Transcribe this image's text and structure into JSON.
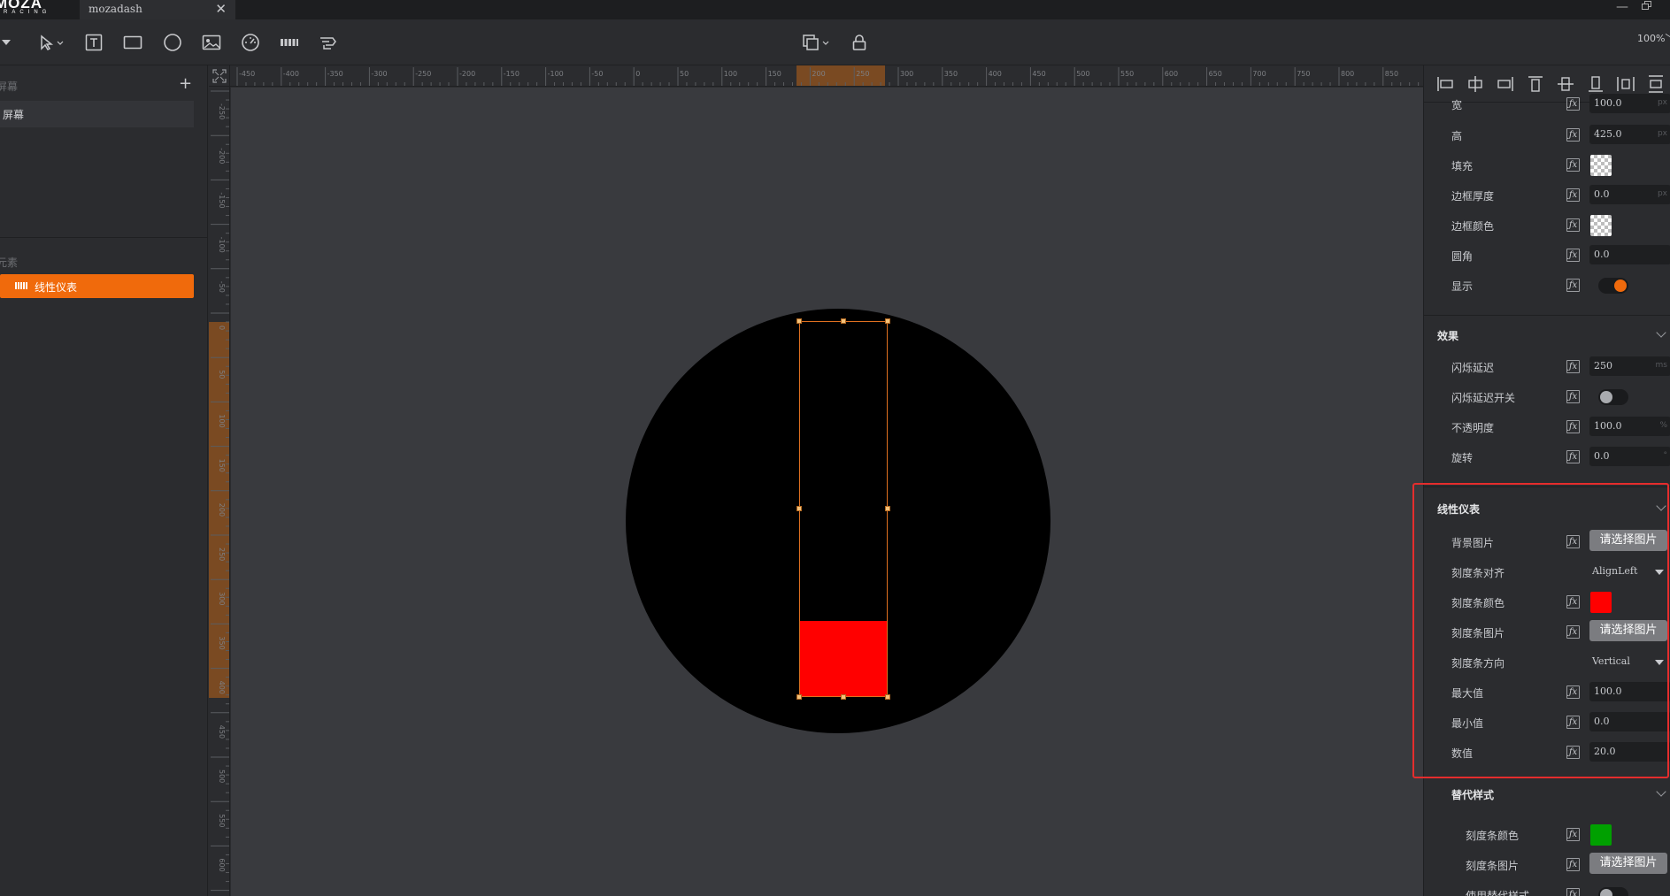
{
  "app": {
    "logo_main": "MOZA",
    "logo_sub": "RACING",
    "doc_tab": "mozadash",
    "zoom": "100%"
  },
  "left_panel": {
    "screens_title": "屏幕",
    "screen_item": "屏幕",
    "elements_title": "元素",
    "element_item": "线性仪表"
  },
  "ruler": {
    "top_ticks": [
      "-450",
      "-400",
      "-350",
      "-300",
      "-250",
      "-200",
      "-150",
      "-100",
      "-50",
      "0",
      "50",
      "100",
      "150",
      "200",
      "250",
      "300",
      "350",
      "400",
      "450",
      "500",
      "550",
      "600",
      "650",
      "700",
      "750",
      "800",
      "850"
    ],
    "left_ticks": [
      "-250",
      "-200",
      "-150",
      "-100",
      "-50",
      "0",
      "50",
      "100",
      "150",
      "200",
      "250",
      "300",
      "350",
      "400",
      "450",
      "500",
      "550",
      "600",
      "650"
    ]
  },
  "canvas": {
    "gauge_value_fraction": 0.2,
    "fill_color": "#ff0000",
    "accent": "#f06a0c"
  },
  "properties": {
    "width": {
      "label": "宽",
      "value": "100.0",
      "unit": "px"
    },
    "height": {
      "label": "高",
      "value": "425.0",
      "unit": "px"
    },
    "fill": {
      "label": "填充"
    },
    "border_width": {
      "label": "边框厚度",
      "value": "0.0",
      "unit": "px"
    },
    "border_color": {
      "label": "边框颜色"
    },
    "radius": {
      "label": "圆角",
      "value": "0.0"
    },
    "visible": {
      "label": "显示"
    },
    "effects": {
      "title": "效果",
      "blink_delay": {
        "label": "闪烁延迟",
        "value": "250",
        "unit": "ms"
      },
      "blink_switch": {
        "label": "闪烁延迟开关"
      },
      "opacity": {
        "label": "不透明度",
        "value": "100.0",
        "unit": "%"
      },
      "rotation": {
        "label": "旋转",
        "value": "0.0",
        "unit": "°"
      }
    },
    "linear_gauge": {
      "title": "线性仪表",
      "bg_image": {
        "label": "背景图片",
        "button": "请选择图片"
      },
      "bar_align": {
        "label": "刻度条对齐",
        "value": "AlignLeft"
      },
      "bar_color": {
        "label": "刻度条颜色",
        "color": "#ff0000"
      },
      "bar_image": {
        "label": "刻度条图片",
        "button": "请选择图片"
      },
      "bar_direction": {
        "label": "刻度条方向",
        "value": "Vertical"
      },
      "max": {
        "label": "最大值",
        "value": "100.0"
      },
      "min": {
        "label": "最小值",
        "value": "0.0"
      },
      "value": {
        "label": "数值",
        "value": "20.0"
      }
    },
    "alt_style": {
      "title": "替代样式",
      "bar_color": {
        "label": "刻度条颜色",
        "color": "#00a000"
      },
      "bar_image": {
        "label": "刻度条图片",
        "button": "请选择图片"
      },
      "use_alt": {
        "label": "使用替代样式"
      }
    }
  }
}
